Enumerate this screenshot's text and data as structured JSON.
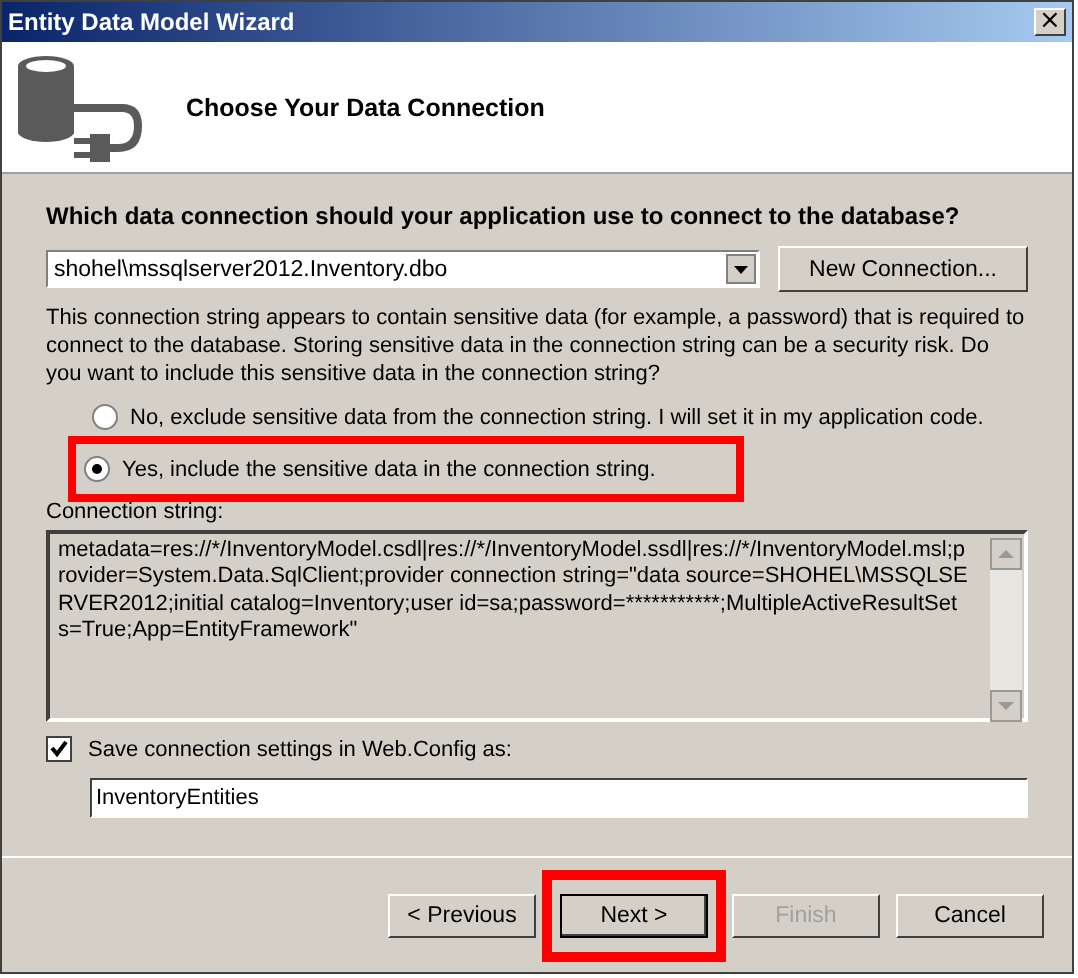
{
  "window": {
    "title": "Entity Data Model Wizard",
    "close": "×"
  },
  "header": {
    "title": "Choose Your Data Connection"
  },
  "question": "Which data connection should your application use to connect to the database?",
  "connection_dropdown": {
    "value": "shohel\\mssqlserver2012.Inventory.dbo"
  },
  "new_connection_button": "New Connection...",
  "warning": "This connection string appears to contain sensitive data (for example, a password) that is required to connect to the database. Storing sensitive data in the connection string can be a security risk. Do you want to include this sensitive data in the connection string?",
  "options": [
    {
      "label": "No, exclude sensitive data from the connection string. I will set it in my application code.",
      "selected": false,
      "highlighted": false
    },
    {
      "label": "Yes, include the sensitive data in the connection string.",
      "selected": true,
      "highlighted": true
    }
  ],
  "connection_string": {
    "label": "Connection string:",
    "value": "metadata=res://*/InventoryModel.csdl|res://*/InventoryModel.ssdl|res://*/InventoryModel.msl;provider=System.Data.SqlClient;provider connection string=\"data source=SHOHEL\\MSSQLSERVER2012;initial catalog=Inventory;user id=sa;password=***********;MultipleActiveResultSets=True;App=EntityFramework\""
  },
  "save_settings": {
    "label": "Save connection settings in Web.Config as:",
    "checked": true,
    "value": "InventoryEntities"
  },
  "buttons": [
    {
      "label": "< Previous",
      "disabled": false,
      "highlighted": false
    },
    {
      "label": "Next >",
      "disabled": false,
      "highlighted": true
    },
    {
      "label": "Finish",
      "disabled": true,
      "highlighted": false
    },
    {
      "label": "Cancel",
      "disabled": false,
      "highlighted": false
    }
  ]
}
